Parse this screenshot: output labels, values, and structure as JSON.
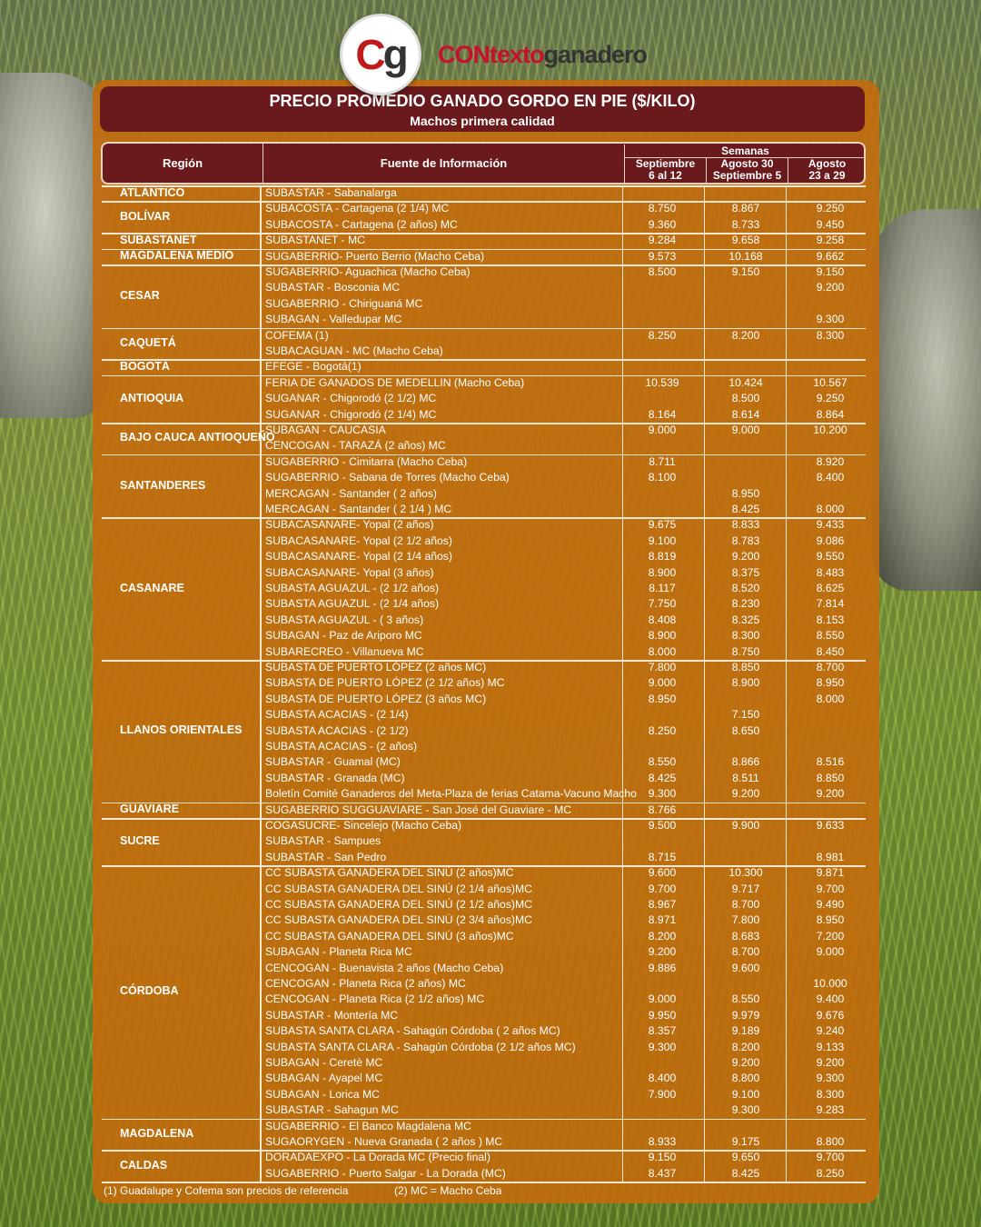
{
  "brand": {
    "logo_c": "C",
    "logo_g": "g",
    "name_part1": "CONtexto",
    "name_part2": "ganadero"
  },
  "title": "PRECIO PROMEDIO GANADO GORDO EN PIE ($/KILO)",
  "subtitle": "Machos primera calidad",
  "headers": {
    "region": "Región",
    "fuente": "Fuente de Información",
    "semanas": "Semanas",
    "week1_l1": "Septiembre",
    "week1_l2": "6 al 12",
    "week2_l1": "Agosto 30",
    "week2_l2": "Septiembre 5",
    "week3_l1": "Agosto",
    "week3_l2": "23 a 29"
  },
  "groups": [
    {
      "region": "ATLÁNTICO",
      "rows": [
        [
          "SUBASTAR - Sabanalarga",
          "",
          "",
          ""
        ]
      ]
    },
    {
      "region": "BOLÍVAR",
      "rows": [
        [
          "SUBACOSTA - Cartagena (2 1/4) MC",
          "8.750",
          "8.867",
          "9.250"
        ],
        [
          "SUBACOSTA - Cartagena (2 años) MC",
          "9.360",
          "8.733",
          "9.450"
        ]
      ]
    },
    {
      "region": "SUBASTANET",
      "rows": [
        [
          "SUBASTANET - MC",
          "9.284",
          "9.658",
          "9.258"
        ]
      ]
    },
    {
      "region": "MAGDALENA MEDIO",
      "rows": [
        [
          "SUGABERRIO- Puerto Berrio (Macho Ceba)",
          "9.573",
          "10.168",
          "9.662"
        ]
      ]
    },
    {
      "region": "CESAR",
      "rows": [
        [
          "SUGABERRIO- Aguachica  (Macho Ceba)",
          "8.500",
          "9.150",
          "9.150"
        ],
        [
          "SUBASTAR - Bosconia MC",
          "",
          "",
          "9.200"
        ],
        [
          "SUGABERRIO - Chiriguaná MC",
          "",
          "",
          ""
        ],
        [
          "SUBAGAN - Valledupar MC",
          "",
          "",
          "9.300"
        ]
      ]
    },
    {
      "region": "CAQUETÁ",
      "rows": [
        [
          "COFEMA (1)",
          "8.250",
          "8.200",
          "8.300"
        ],
        [
          "SUBACAGUAN - MC (Macho Ceba)",
          "",
          "",
          ""
        ]
      ]
    },
    {
      "region": "BOGOTÁ",
      "rows": [
        [
          "EFEGE - Bogotá(1)",
          "",
          "",
          ""
        ]
      ]
    },
    {
      "region": "ANTIOQUIA",
      "rows": [
        [
          "FERIA DE GANADOS DE MEDELLIN (Macho Ceba)",
          "10.539",
          "10.424",
          "10.567"
        ],
        [
          "SUGANAR - Chigorodó (2 1/2) MC",
          "",
          "8.500",
          "9.250"
        ],
        [
          "SUGANAR - Chigorodó (2 1/4) MC",
          "8.164",
          "8.614",
          "8.864"
        ]
      ]
    },
    {
      "region": "BAJO CAUCA ANTIOQUEÑO",
      "rows": [
        [
          "SUBAGAN - CAUCASIA",
          "9.000",
          "9.000",
          "10.200"
        ],
        [
          "CENCOGAN - TARAZÁ (2 años) MC",
          "",
          "",
          ""
        ]
      ]
    },
    {
      "region": "SANTANDERES",
      "rows": [
        [
          "SUGABERRIO - Cimitarra (Macho Ceba)",
          "8.711",
          "",
          "8.920"
        ],
        [
          "SUGABERRIO - Sabana de Torres (Macho Ceba)",
          "8.100",
          "",
          "8.400"
        ],
        [
          "MERCAGAN - Santander ( 2 años)",
          "",
          "8.950",
          ""
        ],
        [
          "MERCAGAN - Santander ( 2 1/4 ) MC",
          "",
          "8.425",
          "8.000"
        ]
      ]
    },
    {
      "region": "CASANARE",
      "rows": [
        [
          "SUBACASANARE- Yopal (2 años)",
          "9.675",
          "8.833",
          "9.433"
        ],
        [
          "SUBACASANARE- Yopal (2 1/2 años)",
          "9.100",
          "8.783",
          "9.086"
        ],
        [
          "SUBACASANARE- Yopal (2 1/4 años)",
          "8.819",
          "9.200",
          "9.550"
        ],
        [
          "SUBACASANARE- Yopal (3 años)",
          "8.900",
          "8.375",
          "8.483"
        ],
        [
          "SUBASTA AGUAZUL - (2 1/2 años)",
          "8.117",
          "8.520",
          "8.625"
        ],
        [
          "SUBASTA AGUAZUL - (2 1/4 años)",
          "7.750",
          "8.230",
          "7.814"
        ],
        [
          "SUBASTA AGUAZUL - ( 3 años)",
          "8.408",
          "8.325",
          "8.153"
        ],
        [
          "SUBAGAN - Paz de Ariporo MC",
          "8.900",
          "8.300",
          "8.550"
        ],
        [
          "SUBARECREO - Villanueva MC",
          "8.000",
          "8.750",
          "8.450"
        ]
      ]
    },
    {
      "region": "LLANOS ORIENTALES",
      "rows": [
        [
          "SUBASTA DE PUERTO LÓPEZ (2 años MC)",
          "7.800",
          "8.850",
          "8.700"
        ],
        [
          "SUBASTA DE PUERTO LÓPEZ (2 1/2 años) MC",
          "9.000",
          "8.900",
          "8.950"
        ],
        [
          "SUBASTA DE PUERTO LÓPEZ (3 años MC)",
          "8.950",
          "",
          "8.000"
        ],
        [
          "SUBASTA ACACIAS -  (2 1/4)",
          "",
          "7.150",
          ""
        ],
        [
          "SUBASTA ACACIAS - (2 1/2)",
          "8.250",
          "8.650",
          ""
        ],
        [
          "SUBASTA ACACIAS - (2 años)",
          "",
          "",
          ""
        ],
        [
          "SUBASTAR - Guamal (MC)",
          "8.550",
          "8.866",
          "8.516"
        ],
        [
          "SUBASTAR - Granada (MC)",
          "8.425",
          "8.511",
          "8.850"
        ],
        [
          "Boletín Comité Ganaderos del Meta-Plaza de ferias Catama-Vacuno Macho",
          "9.300",
          "9.200",
          "9.200"
        ]
      ]
    },
    {
      "region": "GUAVIARE",
      "rows": [
        [
          "SUGABERRIO SUGGUAVIARE - San José del Guaviare - MC",
          "8.766",
          "",
          ""
        ]
      ]
    },
    {
      "region": "SUCRE",
      "rows": [
        [
          "COGASUCRE- Sincelejo (Macho Ceba)",
          "9.500",
          "9.900",
          "9.633"
        ],
        [
          "SUBASTAR - Sampues",
          "",
          "",
          ""
        ],
        [
          "SUBASTAR - San Pedro",
          "8.715",
          "",
          "8.981"
        ]
      ]
    },
    {
      "region": "CÓRDOBA",
      "rows": [
        [
          "CC SUBASTA GANADERA DEL SINÚ (2 años)MC",
          "9.600",
          "10.300",
          "9.871"
        ],
        [
          "CC SUBASTA GANADERA DEL SINÚ (2 1/4 años)MC",
          "9.700",
          "9.717",
          "9.700"
        ],
        [
          "CC SUBASTA GANADERA DEL SINÚ (2 1/2 años)MC",
          "8.967",
          "8.700",
          "9.490"
        ],
        [
          "CC SUBASTA GANADERA DEL SINÚ (2 3/4 años)MC",
          "8.971",
          "7.800",
          "8.950"
        ],
        [
          "CC SUBASTA GANADERA DEL SINÚ (3 años)MC",
          "8.200",
          "8.683",
          "7.200"
        ],
        [
          "SUBAGAN - Planeta Rica MC",
          "9.200",
          "8.700",
          "9.000"
        ],
        [
          "CENCOGAN - Buenavista 2 años (Macho Ceba)",
          "9.886",
          "9.600",
          ""
        ],
        [
          "CENCOGAN - Planeta Rica (2 años) MC",
          "",
          "",
          "10.000"
        ],
        [
          "CENCOGAN - Planeta Rica (2 1/2 años) MC",
          "9.000",
          "8.550",
          "9.400"
        ],
        [
          "SUBASTAR - Montería MC",
          "9.950",
          "9.979",
          "9.676"
        ],
        [
          "SUBASTA SANTA CLARA - Sahagún Córdoba ( 2 años MC)",
          "8.357",
          "9.189",
          "9.240"
        ],
        [
          "SUBASTA SANTA CLARA - Sahagún Córdoba (2 1/2 años MC)",
          "9.300",
          "8.200",
          "9.133"
        ],
        [
          "SUBAGAN - Ceretè MC",
          "",
          "9.200",
          "9.200"
        ],
        [
          "SUBAGAN - Ayapel MC",
          "8.400",
          "8.800",
          "9.300"
        ],
        [
          "SUBAGAN - Lorica MC",
          "7.900",
          "9.100",
          "8.300"
        ],
        [
          "SUBASTAR - Sahagun MC",
          "",
          "9.300",
          "9.283"
        ]
      ]
    },
    {
      "region": "MAGDALENA",
      "rows": [
        [
          "SUGABERRIO - El Banco Magdalena MC",
          "",
          "",
          ""
        ],
        [
          "SUGAORYGEN - Nueva Granada ( 2 años ) MC",
          "8.933",
          "9.175",
          "8.800"
        ]
      ]
    },
    {
      "region": "CALDAS",
      "rows": [
        [
          "DORADAEXPO - La Dorada MC (Precio final)",
          "9.150",
          "9.650",
          "9.700"
        ],
        [
          "SUGABERRIO - Puerto Salgar - La Dorada (MC)",
          "8.437",
          "8.425",
          "8.250"
        ]
      ]
    }
  ],
  "footer": {
    "note1": "(1) Guadalupe y Cofema son precios de referencia",
    "note2": "(2) MC = Macho Ceba"
  }
}
